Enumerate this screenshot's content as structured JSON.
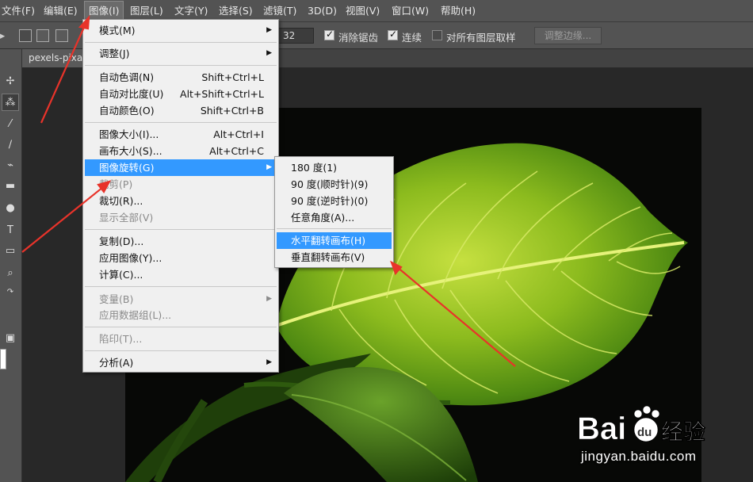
{
  "menubar": {
    "items": [
      "文件(F)",
      "编辑(E)",
      "图像(I)",
      "图层(L)",
      "文字(Y)",
      "选择(S)",
      "滤镜(T)",
      "3D(D)",
      "视图(V)",
      "窗口(W)",
      "帮助(H)"
    ],
    "active": "图像(I)"
  },
  "options": {
    "tolerance": "32",
    "antialias_label": "消除锯齿",
    "contiguous_label": "连续",
    "sample_all_label": "对所有图层取样",
    "refine_edge_label": "调整边缘..."
  },
  "document": {
    "tab_label": "pexels-pixab"
  },
  "image_menu": {
    "items": [
      {
        "label": "模式(M)",
        "shortcut": "",
        "submenu": true,
        "disabled": false
      },
      {
        "label": "调整(J)",
        "shortcut": "",
        "submenu": true,
        "disabled": false
      },
      {
        "label": "自动色调(N)",
        "shortcut": "Shift+Ctrl+L",
        "submenu": false,
        "disabled": false
      },
      {
        "label": "自动对比度(U)",
        "shortcut": "Alt+Shift+Ctrl+L",
        "submenu": false,
        "disabled": false
      },
      {
        "label": "自动颜色(O)",
        "shortcut": "Shift+Ctrl+B",
        "submenu": false,
        "disabled": false
      },
      {
        "label": "图像大小(I)...",
        "shortcut": "Alt+Ctrl+I",
        "submenu": false,
        "disabled": false
      },
      {
        "label": "画布大小(S)...",
        "shortcut": "Alt+Ctrl+C",
        "submenu": false,
        "disabled": false
      },
      {
        "label": "图像旋转(G)",
        "shortcut": "",
        "submenu": true,
        "disabled": false,
        "highlighted": true
      },
      {
        "label": "裁剪(P)",
        "shortcut": "",
        "submenu": false,
        "disabled": true
      },
      {
        "label": "裁切(R)...",
        "shortcut": "",
        "submenu": false,
        "disabled": false
      },
      {
        "label": "显示全部(V)",
        "shortcut": "",
        "submenu": false,
        "disabled": true
      },
      {
        "label": "复制(D)...",
        "shortcut": "",
        "submenu": false,
        "disabled": false
      },
      {
        "label": "应用图像(Y)...",
        "shortcut": "",
        "submenu": false,
        "disabled": false
      },
      {
        "label": "计算(C)...",
        "shortcut": "",
        "submenu": false,
        "disabled": false
      },
      {
        "label": "变量(B)",
        "shortcut": "",
        "submenu": true,
        "disabled": true
      },
      {
        "label": "应用数据组(L)...",
        "shortcut": "",
        "submenu": false,
        "disabled": true
      },
      {
        "label": "陷印(T)...",
        "shortcut": "",
        "submenu": false,
        "disabled": true
      },
      {
        "label": "分析(A)",
        "shortcut": "",
        "submenu": true,
        "disabled": false
      }
    ]
  },
  "rotation_submenu": {
    "items": [
      {
        "label": "180 度(1)",
        "highlighted": false
      },
      {
        "label": "90 度(顺时针)(9)",
        "highlighted": false
      },
      {
        "label": "90 度(逆时针)(0)",
        "highlighted": false
      },
      {
        "label": "任意角度(A)...",
        "highlighted": false
      },
      {
        "label": "水平翻转画布(H)",
        "highlighted": true
      },
      {
        "label": "垂直翻转画布(V)",
        "highlighted": false
      }
    ]
  },
  "watermark": {
    "brand": "Bai",
    "brand_tail": "经验",
    "paw_text": "du",
    "url": "jingyan.baidu.com"
  },
  "colors": {
    "menu_bg": "#f0f0f0",
    "menu_highlight": "#3399ff",
    "annotation_arrow": "#e8332a",
    "app_bg": "#535353"
  }
}
